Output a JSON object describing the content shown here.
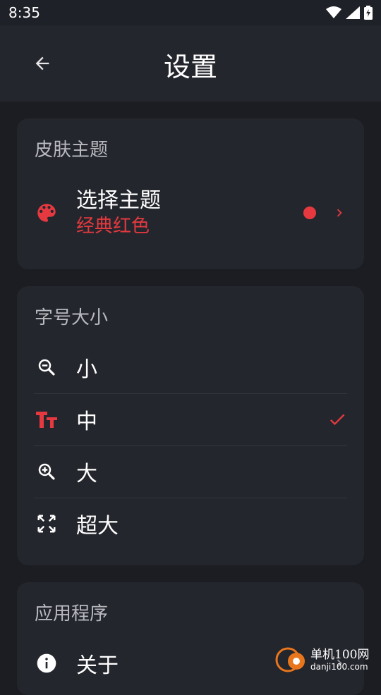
{
  "status_bar": {
    "time": "8:35"
  },
  "app_bar": {
    "title": "设置"
  },
  "skin_section": {
    "title": "皮肤主题",
    "item": {
      "label": "选择主题",
      "value": "经典红色"
    }
  },
  "font_section": {
    "title": "字号大小",
    "items": [
      {
        "label": "小",
        "selected": false
      },
      {
        "label": "中",
        "selected": true
      },
      {
        "label": "大",
        "selected": false
      },
      {
        "label": "超大",
        "selected": false
      }
    ]
  },
  "app_section": {
    "title": "应用程序",
    "items": [
      {
        "label": "关于"
      }
    ]
  },
  "watermark": {
    "name": "单机100网",
    "url": "danji100.com"
  },
  "colors": {
    "accent": "#e5393f",
    "background": "#1b1d23",
    "card": "#24262d"
  }
}
